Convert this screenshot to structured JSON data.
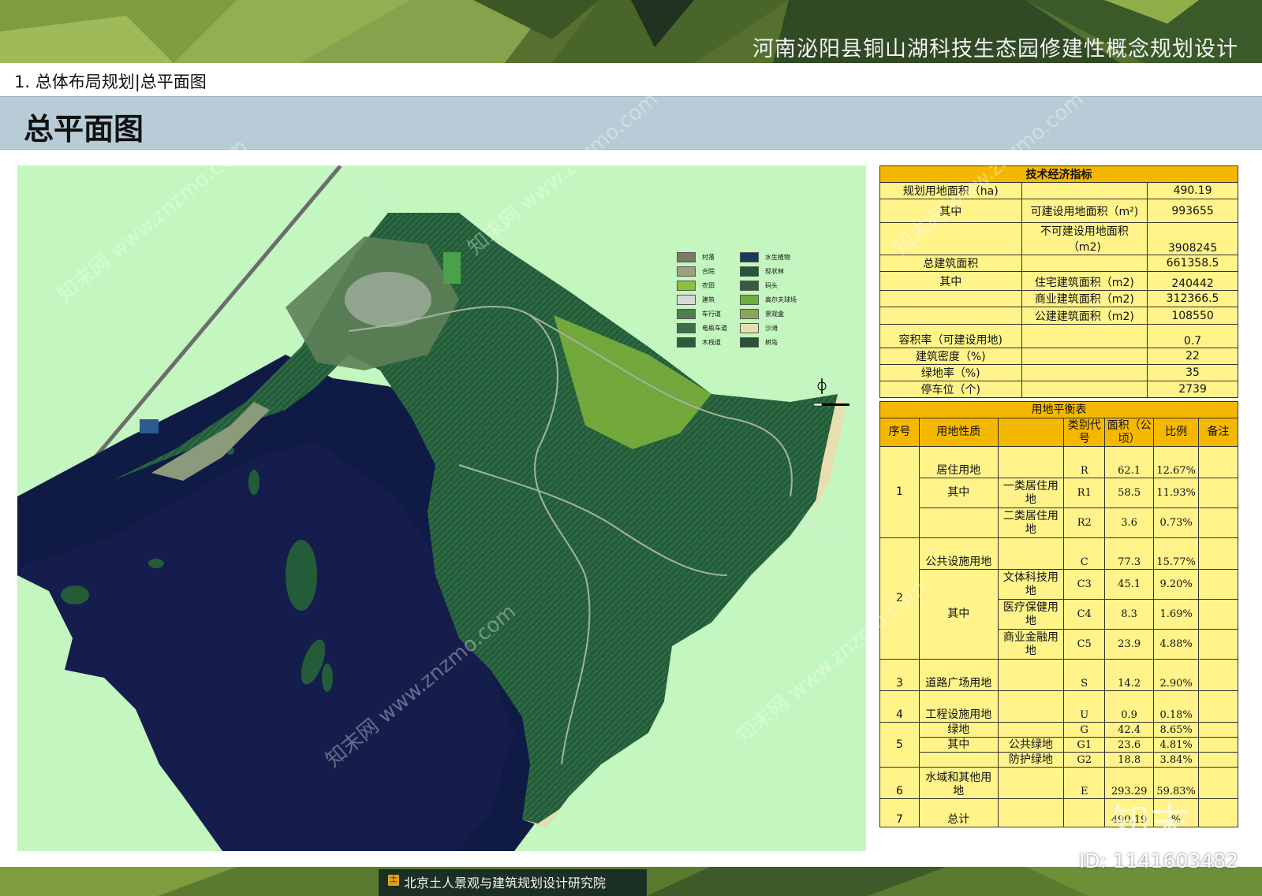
{
  "header": {
    "project_title": "河南泌阳县铜山湖科技生态园修建性概念规划设计",
    "section_label": "1. 总体布局规划|总平面图",
    "page_title": "总平面图"
  },
  "legend": {
    "items": [
      {
        "label": "村落",
        "color": "#7a7d64"
      },
      {
        "label": "合院",
        "color": "#9ba37a"
      },
      {
        "label": "农田",
        "color": "#8fbf3c"
      },
      {
        "label": "建筑",
        "color": "#d9d9d9"
      },
      {
        "label": "车行道",
        "color": "#4f7d52"
      },
      {
        "label": "电瓶车道",
        "color": "#3f6f4a"
      },
      {
        "label": "木栈道",
        "color": "#2f5a3c"
      },
      {
        "label": "水生植物",
        "color": "#1b3a5a"
      },
      {
        "label": "现状林",
        "color": "#1f5a38"
      },
      {
        "label": "码头",
        "color": "#355c40"
      },
      {
        "label": "高尔夫球场",
        "color": "#6fae3a"
      },
      {
        "label": "景观盒",
        "color": "#8ba65a"
      },
      {
        "label": "沙滩",
        "color": "#e8dfb0"
      },
      {
        "label": "树岛",
        "color": "#2e4f3a"
      }
    ]
  },
  "tech_table": {
    "title": "技术经济指标",
    "r1": {
      "label": "规划用地面积（ha)",
      "sub": "",
      "value": "490.19"
    },
    "r2": {
      "label": "其中",
      "sub": "可建设用地面积（m²)",
      "value": "993655"
    },
    "r3": {
      "label": "",
      "sub": "不可建设用地面积（m2)",
      "value": "3908245"
    },
    "r4": {
      "label": "总建筑面积",
      "sub": "",
      "value": "661358.5"
    },
    "r5": {
      "label": "其中",
      "sub": "住宅建筑面积（m2)",
      "value": "240442"
    },
    "r6": {
      "label": "",
      "sub": "商业建筑面积（m2)",
      "value": "312366.5"
    },
    "r7": {
      "label": "",
      "sub": "公建建筑面积（m2)",
      "value": "108550"
    },
    "r8": {
      "label": "容积率（可建设用地)",
      "sub": "",
      "value": "0.7"
    },
    "r9": {
      "label": "建筑密度（%)",
      "sub": "",
      "value": "22"
    },
    "r10": {
      "label": "绿地率（%)",
      "sub": "",
      "value": "35"
    },
    "r11": {
      "label": "停车位（个)",
      "sub": "",
      "value": "2739"
    }
  },
  "land_table": {
    "title": "用地平衡表",
    "headers": {
      "no": "序号",
      "type": "用地性质",
      "code": "类别代号",
      "area": "面积（公顷）",
      "ratio": "比例",
      "note": "备注"
    },
    "rows": {
      "r1": {
        "no": "1",
        "type": "居住用地",
        "sub": "",
        "code": "R",
        "area": "62.1",
        "ratio": "12.67%"
      },
      "r2": {
        "type": "其中",
        "sub": "一类居住用地",
        "code": "R1",
        "area": "58.5",
        "ratio": "11.93%"
      },
      "r3": {
        "sub": "二类居住用地",
        "code": "R2",
        "area": "3.6",
        "ratio": "0.73%"
      },
      "r4": {
        "no": "2",
        "type": "公共设施用地",
        "code": "C",
        "area": "77.3",
        "ratio": "15.77%"
      },
      "r5": {
        "type": "其中",
        "sub": "文体科技用地",
        "code": "C3",
        "area": "45.1",
        "ratio": "9.20%"
      },
      "r6": {
        "sub": "医疗保健用地",
        "code": "C4",
        "area": "8.3",
        "ratio": "1.69%"
      },
      "r7": {
        "sub": "商业金融用地",
        "code": "C5",
        "area": "23.9",
        "ratio": "4.88%"
      },
      "r8": {
        "no": "3",
        "type": "道路广场用地",
        "code": "S",
        "area": "14.2",
        "ratio": "2.90%"
      },
      "r9": {
        "no": "4",
        "type": "工程设施用地",
        "code": "U",
        "area": "0.9",
        "ratio": "0.18%"
      },
      "r10": {
        "no": "5",
        "type": "绿地",
        "code": "G",
        "area": "42.4",
        "ratio": "8.65%"
      },
      "r11": {
        "type": "其中",
        "sub": "公共绿地",
        "code": "G1",
        "area": "23.6",
        "ratio": "4.81%"
      },
      "r12": {
        "sub": "防护绿地",
        "code": "G2",
        "area": "18.8",
        "ratio": "3.84%"
      },
      "r13": {
        "no": "6",
        "type": "水域和其他用地",
        "code": "E",
        "area": "293.29",
        "ratio": "59.83%"
      },
      "r14": {
        "no": "7",
        "type": "总计",
        "code": "",
        "area": "490.19",
        "ratio": "%"
      }
    }
  },
  "footer": {
    "institute": "北京土人景观与建筑规划设计研究院",
    "logo_mark": "知末",
    "image_id": "ID: 1141603482"
  },
  "watermark": "知末网 www.znzmo.com"
}
